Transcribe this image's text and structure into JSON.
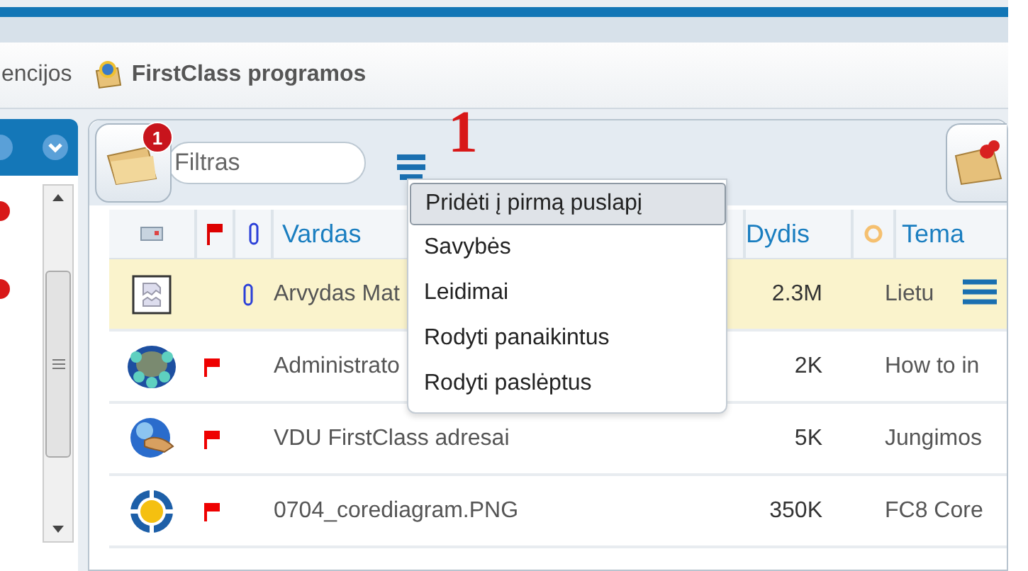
{
  "breadcrumb": {
    "items": [
      {
        "label": "encijos"
      },
      {
        "label": "FirstClass programos"
      }
    ]
  },
  "toolbar": {
    "badge": "1",
    "filter": {
      "placeholder": "Filtras"
    },
    "annotation": "1"
  },
  "menu": {
    "items": [
      {
        "label": "Pridėti į pirmą puslapį",
        "selected": true
      },
      {
        "label": "Savybės",
        "selected": false
      },
      {
        "label": "Leidimai",
        "selected": false
      },
      {
        "label": "Rodyti panaikintus",
        "selected": false
      },
      {
        "label": "Rodyti paslėptus",
        "selected": false
      }
    ]
  },
  "table": {
    "columns": [
      {
        "kind": "icon"
      },
      {
        "kind": "flag"
      },
      {
        "kind": "attach"
      },
      {
        "kind": "text",
        "label": "Vardas"
      },
      {
        "kind": "text",
        "label": "Dydis"
      },
      {
        "kind": "circle"
      },
      {
        "kind": "text",
        "label": "Tema"
      }
    ],
    "rows": [
      {
        "flagged": false,
        "attachment": true,
        "name": "Arvydas Mat",
        "size": "2.3M",
        "subject": "Lietu",
        "selected": true,
        "menu_icon": true
      },
      {
        "flagged": true,
        "attachment": false,
        "name": "Administrato",
        "size": "2K",
        "subject": "How to in",
        "selected": false,
        "menu_icon": false
      },
      {
        "flagged": true,
        "attachment": false,
        "name": "VDU FirstClass adresai",
        "size": "5K",
        "subject": "Jungimos",
        "selected": false,
        "menu_icon": false
      },
      {
        "flagged": true,
        "attachment": false,
        "name": "0704_corediagram.PNG",
        "size": "350K",
        "subject": "FC8 Core",
        "selected": false,
        "menu_icon": false
      }
    ]
  },
  "sidebar": {
    "items": [
      {
        "unread": true
      },
      {
        "unread": true
      }
    ]
  }
}
